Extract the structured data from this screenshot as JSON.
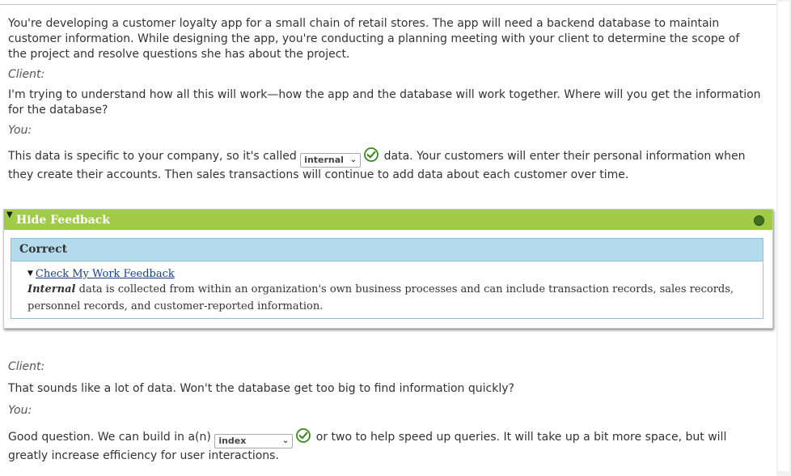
{
  "scenario": {
    "intro": "You're developing a customer loyalty app for a small chain of retail stores. The app will need a backend database to maintain customer information. While designing the app, you're conducting a planning meeting with your client to determine the scope of the project and resolve questions she has about the project."
  },
  "dialogue1": {
    "client_label": "Client:",
    "client_question": "I'm trying to understand how all this will work—how the app and the database will work together. Where will you get the information for the database?",
    "you_label": "You:",
    "answer_before": "This data is specific to your company, so it's called",
    "select_value": "internal",
    "answer_after": "data. Your customers will enter their personal information when they create their accounts. Then sales transactions will continue to add data about each customer over time."
  },
  "feedback": {
    "toggle_label": "Hide Feedback",
    "result_title": "Correct",
    "link_label": "Check My Work Feedback",
    "term": "Internal",
    "explanation": " data is collected from within an organization's own business processes and can include transaction records, sales records, personnel records, and customer-reported information."
  },
  "dialogue2": {
    "client_label": "Client:",
    "client_question": "That sounds like a lot of data. Won't the database get too big to find information quickly?",
    "you_label": "You:",
    "answer_before": "Good question. We can build in a(n)",
    "select_value": "index",
    "answer_after": "or two to help speed up queries. It will take up a bit more space, but will greatly increase efficiency for user interactions."
  },
  "icons": {
    "check": "check-circle-icon",
    "dropdown": "chevron-down-icon",
    "status": "status-dot-icon"
  },
  "colors": {
    "feedback_header": "#a0cb45",
    "correct_panel": "#b4dcec",
    "check_green": "#3a8a1e",
    "link": "#1a3f8a"
  }
}
